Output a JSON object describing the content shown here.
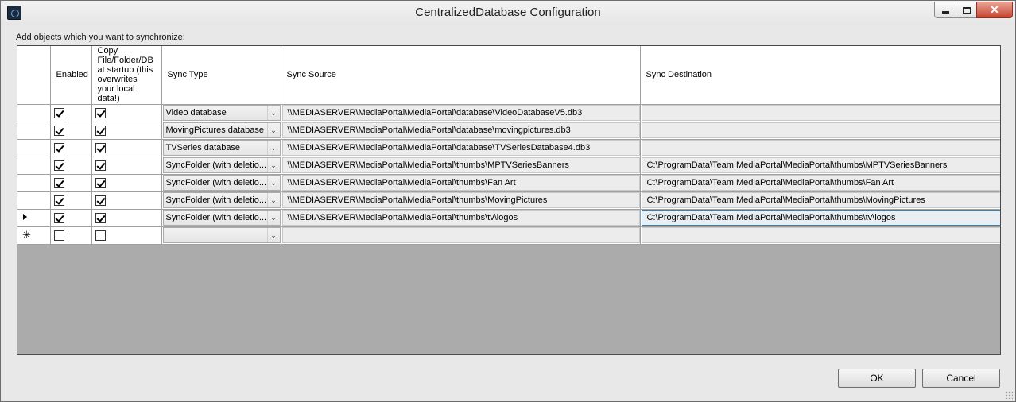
{
  "window": {
    "title": "CentralizedDatabase Configuration",
    "close_glyph": "✕",
    "icons": {
      "app": "app-icon",
      "minimize": "minimize-icon",
      "maximize": "maximize-icon",
      "close": "close-icon"
    }
  },
  "instruction": "Add objects which you want to synchronize:",
  "grid": {
    "columns": {
      "enabled": "Enabled",
      "copy": "Copy File/Folder/DB at startup (this overwrites your local data!)",
      "sync_type": "Sync Type",
      "sync_source": "Sync Source",
      "sync_destination": "Sync Destination"
    },
    "rows": [
      {
        "enabled": true,
        "copy": true,
        "sync_type": "Video database",
        "sync_source": "\\\\MEDIASERVER\\MediaPortal\\MediaPortal\\database\\VideoDatabaseV5.db3",
        "sync_destination": ""
      },
      {
        "enabled": true,
        "copy": true,
        "sync_type": "MovingPictures database",
        "sync_source": "\\\\MEDIASERVER\\MediaPortal\\MediaPortal\\database\\movingpictures.db3",
        "sync_destination": ""
      },
      {
        "enabled": true,
        "copy": true,
        "sync_type": "TVSeries database",
        "sync_source": "\\\\MEDIASERVER\\MediaPortal\\MediaPortal\\database\\TVSeriesDatabase4.db3",
        "sync_destination": ""
      },
      {
        "enabled": true,
        "copy": true,
        "sync_type": "SyncFolder (with deletio...",
        "sync_source": "\\\\MEDIASERVER\\MediaPortal\\MediaPortal\\thumbs\\MPTVSeriesBanners",
        "sync_destination": "C:\\ProgramData\\Team MediaPortal\\MediaPortal\\thumbs\\MPTVSeriesBanners"
      },
      {
        "enabled": true,
        "copy": true,
        "sync_type": "SyncFolder (with deletio...",
        "sync_source": "\\\\MEDIASERVER\\MediaPortal\\MediaPortal\\thumbs\\Fan Art",
        "sync_destination": "C:\\ProgramData\\Team MediaPortal\\MediaPortal\\thumbs\\Fan Art"
      },
      {
        "enabled": true,
        "copy": true,
        "sync_type": "SyncFolder (with deletio...",
        "sync_source": "\\\\MEDIASERVER\\MediaPortal\\MediaPortal\\thumbs\\MovingPictures",
        "sync_destination": "C:\\ProgramData\\Team MediaPortal\\MediaPortal\\thumbs\\MovingPictures"
      },
      {
        "enabled": true,
        "copy": true,
        "sync_type": "SyncFolder (with deletio...",
        "sync_source": "\\\\MEDIASERVER\\MediaPortal\\MediaPortal\\thumbs\\tv\\logos",
        "sync_destination": "C:\\ProgramData\\Team MediaPortal\\MediaPortal\\thumbs\\tv\\logos",
        "current": true
      },
      {
        "enabled": false,
        "copy": false,
        "sync_type": "",
        "sync_source": "",
        "sync_destination": "",
        "new_row": true
      }
    ],
    "new_row_glyph": "✳",
    "dropdown_glyph": "⌄"
  },
  "buttons": {
    "ok": "OK",
    "cancel": "Cancel"
  }
}
